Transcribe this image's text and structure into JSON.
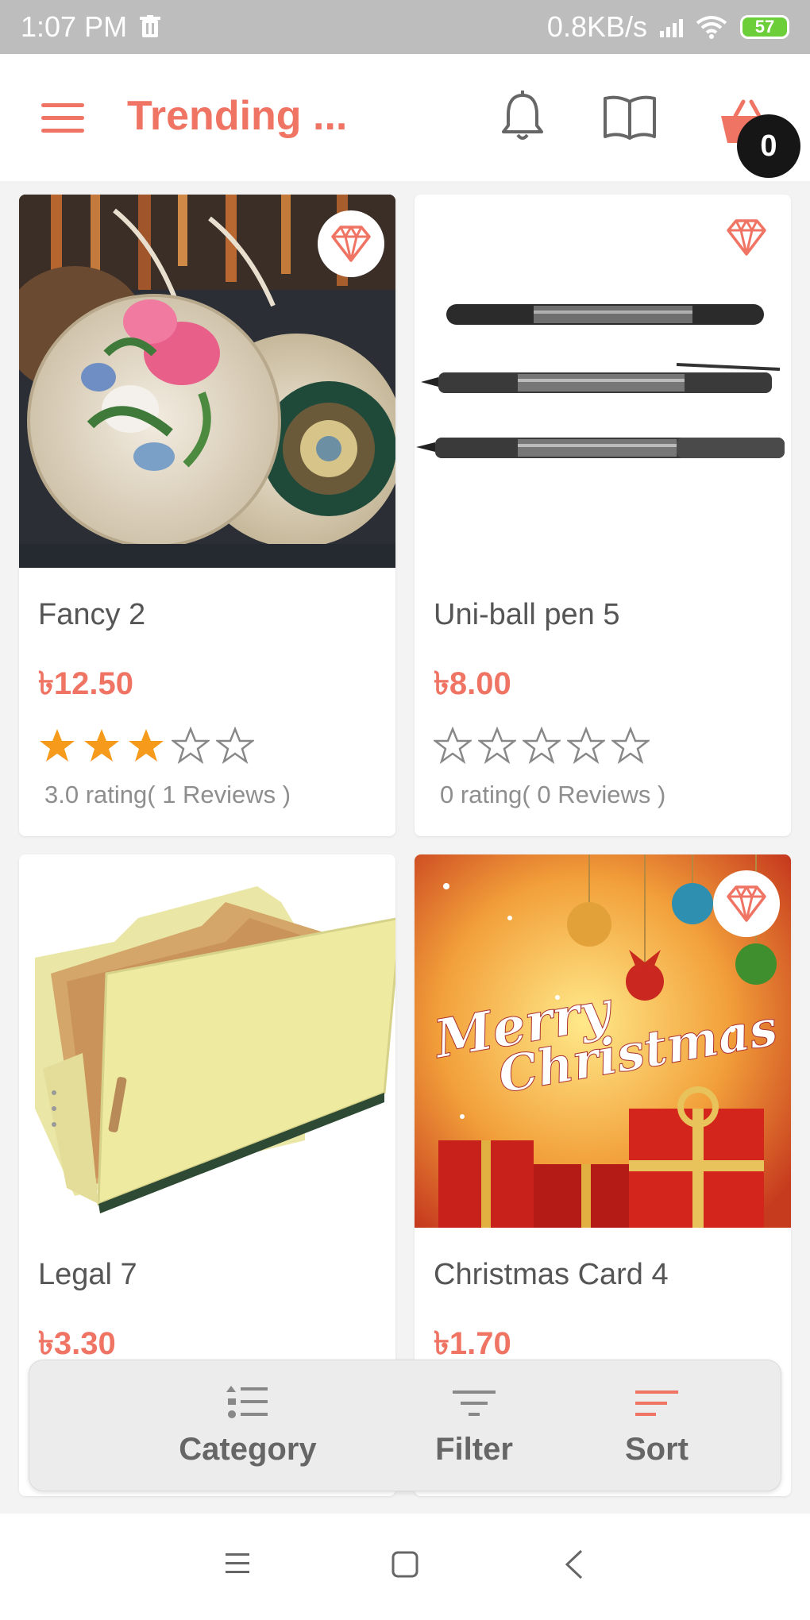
{
  "status_bar": {
    "time": "1:07 PM",
    "network_speed": "0.8KB/s",
    "battery": "57",
    "battery_color": "#6ccf3a"
  },
  "app_bar": {
    "title": "Trending ...",
    "cart_count": "0",
    "icons": [
      "menu-icon",
      "bell-icon",
      "book-icon",
      "basket-icon"
    ],
    "accent_color": "#ef7464"
  },
  "products": [
    {
      "name": "Fancy 2",
      "price": "৳12.50",
      "rating": 3,
      "rating_text": "3.0 rating( 1 Reviews )",
      "image": "woven-bags"
    },
    {
      "name": "Uni-ball pen 5",
      "price": "৳8.00",
      "rating": 0,
      "rating_text": "0 rating( 0 Reviews )",
      "image": "pens"
    },
    {
      "name": "Legal 7",
      "price": "৳3.30",
      "image": "folder"
    },
    {
      "name": "Christmas Card 4",
      "price": "৳1.70",
      "image": "christmas",
      "image_text": [
        "Merry",
        "Christmas"
      ]
    }
  ],
  "actions": {
    "category": "Category",
    "filter": "Filter",
    "sort": "Sort"
  },
  "nav": [
    "recents-icon",
    "home-icon",
    "back-icon"
  ]
}
